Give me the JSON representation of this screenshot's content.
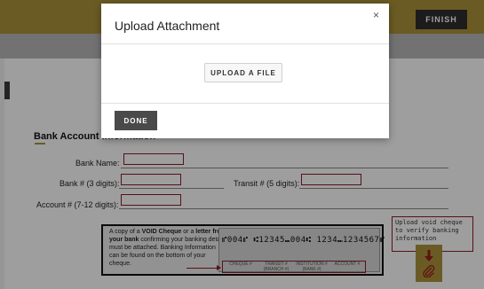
{
  "header": {
    "finish_label": "FINISH"
  },
  "form": {
    "section_title": "Bank Account Information",
    "bank_name_label": "Bank Name:",
    "bank_number_label": "Bank # (3 digits):",
    "transit_label": "Transit # (5 digits):",
    "account_label": "Account # (7-12 digits):"
  },
  "cheque": {
    "desc_a": "A copy of a ",
    "desc_void": "VOID Cheque",
    "desc_b": " or a ",
    "desc_letter": "letter from your bank",
    "desc_c": " confirming your banking details must be attached. Banking Information can be found on the bottom of your cheque.",
    "micr": "⑈004⑈ ⑆12345⑉004⑆ 1234⑉1234567⑈",
    "field_cheque": "CHEQUE #",
    "field_transit": "TRANSIT # (BRANCH #)",
    "field_institution": "INSTITUTION # (BANK #)",
    "field_account": "ACCOUNT #"
  },
  "upload_note": "Upload void cheque to verify banking information",
  "attach_icon": "paperclip-icon",
  "modal": {
    "title": "Upload Attachment",
    "close": "×",
    "upload_label": "UPLOAD A FILE",
    "done_label": "DONE"
  },
  "colors": {
    "accent": "#ab943a",
    "field_border": "#8b1c2a",
    "dark_button": "#4a4a4a"
  }
}
